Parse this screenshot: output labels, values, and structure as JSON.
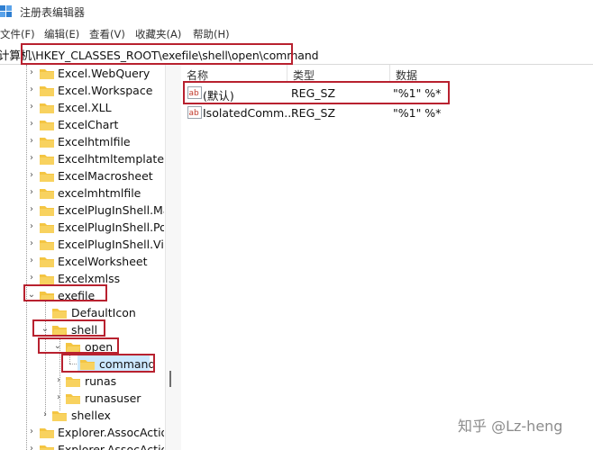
{
  "window": {
    "title": "注册表编辑器"
  },
  "menu": [
    "文件(F)",
    "编辑(E)",
    "查看(V)",
    "收藏夹(A)",
    "帮助(H)"
  ],
  "address": {
    "value": "计算机\\HKEY_CLASSES_ROOT\\exefile\\shell\\open\\command"
  },
  "tree": [
    {
      "label": "Excel.WebQuery"
    },
    {
      "label": "Excel.Workspace"
    },
    {
      "label": "Excel.XLL"
    },
    {
      "label": "ExcelChart"
    },
    {
      "label": "Excelhtmlfile"
    },
    {
      "label": "Excelhtmltemplate"
    },
    {
      "label": "ExcelMacrosheet"
    },
    {
      "label": "excelmhtmlfile"
    },
    {
      "label": "ExcelPlugInShell.Map"
    },
    {
      "label": "ExcelPlugInShell.Powe"
    },
    {
      "label": "ExcelPlugInShell.Visua"
    },
    {
      "label": "ExcelWorksheet"
    },
    {
      "label": "Excelxmlss"
    },
    {
      "label": "exefile"
    },
    {
      "label": "DefaultIcon"
    },
    {
      "label": "shell"
    },
    {
      "label": "open"
    },
    {
      "label": "command"
    },
    {
      "label": "runas"
    },
    {
      "label": "runasuser"
    },
    {
      "label": "shellex"
    },
    {
      "label": "Explorer.AssocAction"
    },
    {
      "label": "Explorer.AssocAction"
    }
  ],
  "columns": {
    "name": "名称",
    "type": "类型",
    "data": "数据"
  },
  "values": [
    {
      "name": "(默认)",
      "type": "REG_SZ",
      "data": "\"%1\" %*",
      "icon": "string-value-icon"
    },
    {
      "name": "IsolatedComm...",
      "type": "REG_SZ",
      "data": "\"%1\" %*",
      "icon": "string-value-icon"
    }
  ],
  "watermark": "知乎 @Lz-heng",
  "colors": {
    "highlight": "#b8212f",
    "folder": "#f4c542",
    "selection": "#cce8ff"
  }
}
